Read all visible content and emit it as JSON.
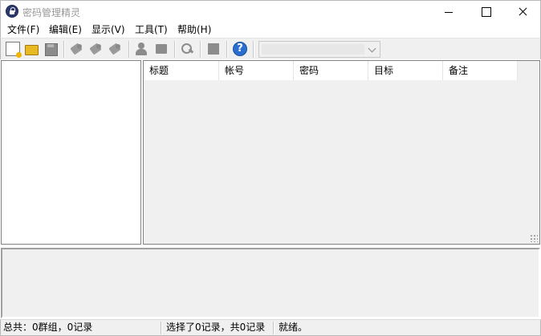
{
  "window": {
    "title": "密码管理精灵"
  },
  "menu": {
    "items": [
      {
        "label": "文件(F)"
      },
      {
        "label": "编辑(E)"
      },
      {
        "label": "显示(V)"
      },
      {
        "label": "工具(T)"
      },
      {
        "label": "帮助(H)"
      }
    ]
  },
  "toolbar": {
    "icons": [
      "new-file-icon",
      "open-folder-icon",
      "save-icon",
      "add-record-icon",
      "edit-record-icon",
      "delete-record-icon",
      "user-group-icon",
      "group-folder-icon",
      "search-icon",
      "lock-square-icon",
      "help-icon"
    ],
    "help_glyph": "?",
    "combo_value": ""
  },
  "list": {
    "columns": [
      {
        "label": "标题"
      },
      {
        "label": "帐号"
      },
      {
        "label": "密码"
      },
      {
        "label": "目标"
      },
      {
        "label": "备注"
      }
    ]
  },
  "status": {
    "summary": "总共：0群组，0记录",
    "selection": "选择了0记录，共0记录",
    "state": "就绪。"
  }
}
